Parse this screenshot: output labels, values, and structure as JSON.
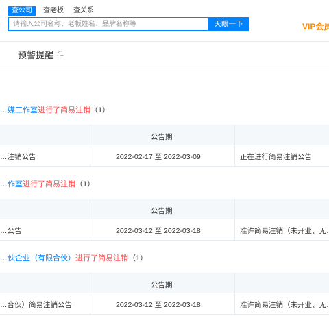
{
  "header": {
    "tabs": [
      "查公司",
      "查老板",
      "查关系"
    ],
    "search_placeholder": "请输入公司名称、老板姓名、品牌名称等",
    "search_button": "天眼一下",
    "vip": "VIP会员"
  },
  "warning": {
    "title": "预警提醒",
    "count": "71"
  },
  "entries": [
    {
      "company": "…媒工作室",
      "action": "进行了简易注销",
      "count": "（1）",
      "header": "公告期",
      "row": {
        "name": "…注销公告",
        "period": "2022-02-17 至 2022-03-09",
        "status": "正在进行简易注销公告"
      }
    },
    {
      "company": "…作室",
      "action": "进行了简易注销",
      "count": "（1）",
      "header": "公告期",
      "row": {
        "name": "…公告",
        "period": "2022-03-12 至 2022-03-18",
        "status": "准许简易注销（未开业、无…"
      }
    },
    {
      "company": "…伙企业（有限合伙）",
      "action": "进行了简易注销",
      "count": "（1）",
      "header": "公告期",
      "row": {
        "name": "…合伙）简易注销公告",
        "period": "2022-03-12 至 2022-03-18",
        "status": "准许简易注销（未开业、无…"
      }
    }
  ],
  "colors": {
    "accent": "#0084ff",
    "warning_text": "#ff4d4f",
    "vip": "#ff8a00"
  }
}
